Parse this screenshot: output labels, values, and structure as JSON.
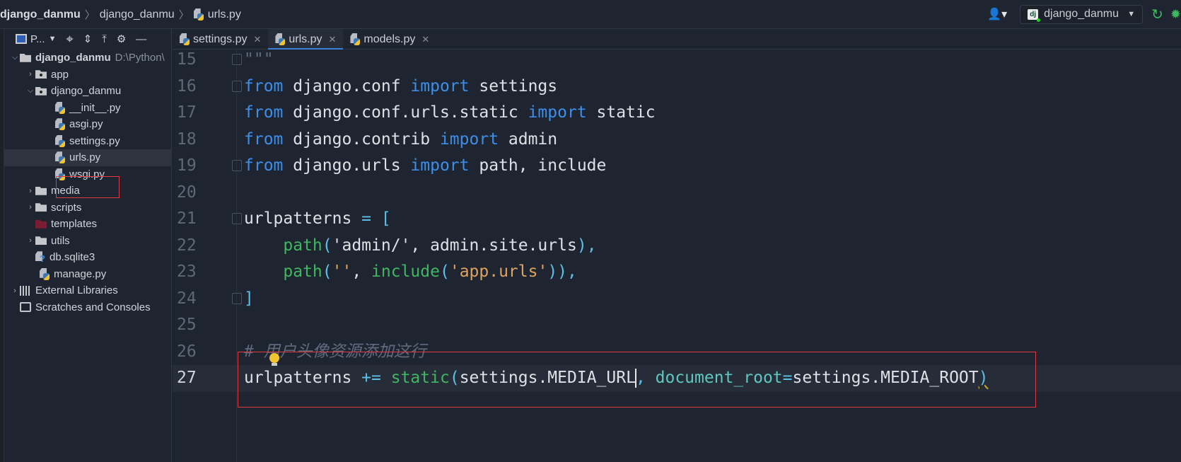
{
  "breadcrumb": [
    "django_danmu",
    "django_danmu",
    "urls.py"
  ],
  "toolbar": {
    "user_icon": "user-icon",
    "run_config": "django_danmu",
    "rerun_icon": "rerun-icon",
    "debug_icon": "bug-icon"
  },
  "project_panel": {
    "title": "P...",
    "icons": [
      "locate-icon",
      "expand-all-icon",
      "collapse-all-icon",
      "gear-icon",
      "minimize-icon"
    ]
  },
  "tree": [
    {
      "label": "django_danmu",
      "extra": "D:\\Python\\",
      "depth": 0,
      "expanded": true,
      "kind": "folder",
      "bold": true
    },
    {
      "label": "app",
      "depth": 1,
      "expanded": false,
      "kind": "module"
    },
    {
      "label": "django_danmu",
      "depth": 1,
      "expanded": true,
      "kind": "module"
    },
    {
      "label": "__init__.py",
      "depth": 2,
      "kind": "py"
    },
    {
      "label": "asgi.py",
      "depth": 2,
      "kind": "py"
    },
    {
      "label": "settings.py",
      "depth": 2,
      "kind": "py"
    },
    {
      "label": "urls.py",
      "depth": 2,
      "kind": "py",
      "selected": true
    },
    {
      "label": "wsgi.py",
      "depth": 2,
      "kind": "py"
    },
    {
      "label": "media",
      "depth": 1,
      "expanded": false,
      "kind": "folder"
    },
    {
      "label": "scripts",
      "depth": 1,
      "expanded": false,
      "kind": "folder"
    },
    {
      "label": "templates",
      "depth": 1,
      "kind": "templates"
    },
    {
      "label": "utils",
      "depth": 1,
      "expanded": false,
      "kind": "folder"
    },
    {
      "label": "db.sqlite3",
      "depth": 1,
      "kind": "unknown"
    },
    {
      "label": "manage.py",
      "depth": 1,
      "kind": "py"
    },
    {
      "label": "External Libraries",
      "depth": 0,
      "expanded": false,
      "kind": "lib"
    },
    {
      "label": "Scratches and Consoles",
      "depth": 0,
      "kind": "scratch"
    }
  ],
  "tabs": [
    {
      "label": "settings.py",
      "active": false
    },
    {
      "label": "urls.py",
      "active": true
    },
    {
      "label": "models.py",
      "active": false
    }
  ],
  "colors": {
    "keyword": "#3d8ee8",
    "plain": "#dde1e6",
    "func": "#3fb760",
    "string": "#e0a35f",
    "comment": "#5f6a7e",
    "punct": "#5cc0e6",
    "kwarg": "#5fc7c0",
    "highlight": "#e0393e"
  },
  "code": [
    {
      "num": "15",
      "fold": true,
      "tokens": [
        [
          "\"\"\"",
          "comment"
        ]
      ]
    },
    {
      "num": "16",
      "fold": true,
      "tokens": [
        [
          "from",
          "keyword"
        ],
        [
          " django.conf ",
          "plain"
        ],
        [
          "import",
          "keyword"
        ],
        [
          " settings",
          "plain"
        ]
      ]
    },
    {
      "num": "17",
      "tokens": [
        [
          "from",
          "keyword"
        ],
        [
          " django.conf.urls.static ",
          "plain"
        ],
        [
          "import",
          "keyword"
        ],
        [
          " static",
          "plain"
        ]
      ]
    },
    {
      "num": "18",
      "tokens": [
        [
          "from",
          "keyword"
        ],
        [
          " django.contrib ",
          "plain"
        ],
        [
          "import",
          "keyword"
        ],
        [
          " admin",
          "plain"
        ]
      ]
    },
    {
      "num": "19",
      "fold": true,
      "tokens": [
        [
          "from",
          "keyword"
        ],
        [
          " django.urls ",
          "plain"
        ],
        [
          "import",
          "keyword"
        ],
        [
          " path, include",
          "plain"
        ]
      ]
    },
    {
      "num": "20",
      "tokens": []
    },
    {
      "num": "21",
      "fold": true,
      "tokens": [
        [
          "urlpatterns ",
          "plain"
        ],
        [
          "=",
          "punct"
        ],
        [
          " ",
          "plain"
        ],
        [
          "[",
          "punct"
        ]
      ]
    },
    {
      "num": "22",
      "tokens": [
        [
          "    ",
          "plain"
        ],
        [
          "path",
          "func"
        ],
        [
          "(",
          "punct"
        ],
        [
          "'admin/'",
          "plain"
        ],
        [
          ", admin.site.urls",
          "plain"
        ],
        [
          ")",
          "punct"
        ],
        [
          ",",
          "punct"
        ]
      ]
    },
    {
      "num": "23",
      "tokens": [
        [
          "    ",
          "plain"
        ],
        [
          "path",
          "func"
        ],
        [
          "(",
          "punct"
        ],
        [
          "''",
          "string"
        ],
        [
          ", ",
          "plain"
        ],
        [
          "include",
          "func"
        ],
        [
          "(",
          "punct"
        ],
        [
          "'app.urls'",
          "string"
        ],
        [
          "))",
          "punct"
        ],
        [
          ",",
          "punct"
        ]
      ]
    },
    {
      "num": "24",
      "fold": true,
      "tokens": [
        [
          "]",
          "punct"
        ]
      ]
    },
    {
      "num": "25",
      "tokens": []
    },
    {
      "num": "26",
      "tokens": [
        [
          "# 用户头像资源添加这行",
          "comment"
        ]
      ]
    },
    {
      "num": "27",
      "current": true,
      "tokens": [
        [
          "urlpatterns ",
          "plain"
        ],
        [
          "+=",
          "punct"
        ],
        [
          " ",
          "plain"
        ],
        [
          "static",
          "func"
        ],
        [
          "(",
          "punct"
        ],
        [
          "settings.MEDIA_URL",
          "plain"
        ],
        [
          "|caret|",
          "caret"
        ],
        [
          ", ",
          "punct"
        ],
        [
          "document_root",
          "kwarg"
        ],
        [
          "=",
          "punct"
        ],
        [
          "settings.MEDIA_ROOT",
          "plain"
        ],
        [
          ")",
          "squig"
        ]
      ]
    }
  ]
}
